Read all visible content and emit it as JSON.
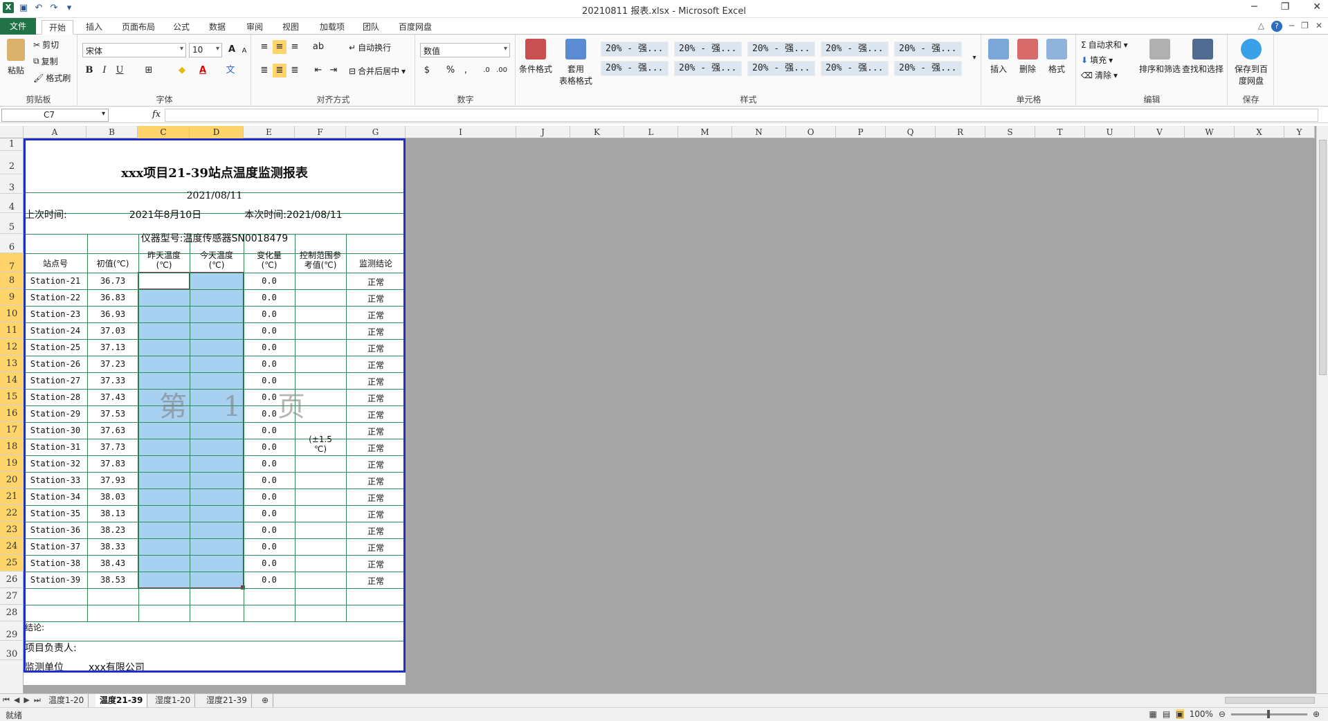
{
  "window": {
    "title": "20210811 报表.xlsx  -  Microsoft Excel",
    "app_icon": "X",
    "qat": [
      "save-icon",
      "undo-icon",
      "redo-icon",
      "customize-icon"
    ],
    "controls": [
      "─",
      "❐",
      "✕"
    ]
  },
  "tabs": [
    "文件",
    "开始",
    "插入",
    "页面布局",
    "公式",
    "数据",
    "审阅",
    "视图",
    "加载项",
    "团队",
    "百度网盘"
  ],
  "ribbon": {
    "clipboard": {
      "label": "剪贴板",
      "paste": "粘贴",
      "cut": "剪切",
      "copy": "复制",
      "format_painter": "格式刷"
    },
    "font": {
      "label": "字体",
      "name": "宋体",
      "size": "10",
      "bold": "B",
      "italic": "I",
      "underline": "U",
      "grow": "A",
      "shrink": "A"
    },
    "alignment": {
      "label": "对齐方式",
      "wrap": "自动换行",
      "merge": "合并后居中"
    },
    "number": {
      "label": "数字",
      "format": "数值",
      "percent": "%",
      "comma": ","
    },
    "styles": {
      "label": "样式",
      "cond": "条件格式",
      "table": "套用\n表格格式",
      "cells": [
        "20% - 强...",
        "20% - 强...",
        "20% - 强...",
        "20% - 强...",
        "20% - 强...",
        "20% - 强...",
        "20% - 强...",
        "20% - 强...",
        "20% - 强...",
        "20% - 强..."
      ]
    },
    "cells": {
      "label": "单元格",
      "insert": "插入",
      "delete": "删除",
      "format": "格式"
    },
    "editing": {
      "label": "编辑",
      "autosum": "自动求和",
      "fill": "填充",
      "clear": "清除",
      "sort": "排序和筛选",
      "find": "查找和选择"
    },
    "save": {
      "label": "保存",
      "baidu": "保存到百\n度网盘"
    }
  },
  "formula_bar": {
    "name_box": "C7",
    "fx": "fx",
    "value": ""
  },
  "columns": [
    "A",
    "B",
    "C",
    "D",
    "E",
    "F",
    "G",
    "I",
    "J",
    "K",
    "L",
    "M",
    "N",
    "O",
    "P",
    "Q",
    "R",
    "S",
    "T",
    "U",
    "V",
    "W",
    "X",
    "Y"
  ],
  "rows": [
    "1",
    "2",
    "3",
    "4",
    "5",
    "6",
    "7",
    "8",
    "9",
    "10",
    "11",
    "12",
    "13",
    "14",
    "15",
    "16",
    "17",
    "18",
    "19",
    "20",
    "21",
    "22",
    "23",
    "24",
    "25",
    "26",
    "27",
    "28",
    "29",
    "30"
  ],
  "report": {
    "title": "xxx项目21-39站点温度监测报表",
    "date": "2021/08/11",
    "last_time_label": "上次时间:",
    "last_time": "2021年8月10日",
    "this_time": "本次时间:2021/08/11",
    "instrument": "仪器型号:温度传感器SN0018479",
    "headers": [
      "站点号",
      "初值(℃)",
      "昨天温度\n(℃)",
      "今天温度\n(℃)",
      "变化量\n(℃)",
      "控制范围参\n考值(℃)",
      "监测结论"
    ],
    "range_value": "(±1.5\n℃)",
    "rows": [
      {
        "station": "Station-21",
        "init": "36.73",
        "change": "0.0",
        "result": "正常"
      },
      {
        "station": "Station-22",
        "init": "36.83",
        "change": "0.0",
        "result": "正常"
      },
      {
        "station": "Station-23",
        "init": "36.93",
        "change": "0.0",
        "result": "正常"
      },
      {
        "station": "Station-24",
        "init": "37.03",
        "change": "0.0",
        "result": "正常"
      },
      {
        "station": "Station-25",
        "init": "37.13",
        "change": "0.0",
        "result": "正常"
      },
      {
        "station": "Station-26",
        "init": "37.23",
        "change": "0.0",
        "result": "正常"
      },
      {
        "station": "Station-27",
        "init": "37.33",
        "change": "0.0",
        "result": "正常"
      },
      {
        "station": "Station-28",
        "init": "37.43",
        "change": "0.0",
        "result": "正常"
      },
      {
        "station": "Station-29",
        "init": "37.53",
        "change": "0.0",
        "result": "正常"
      },
      {
        "station": "Station-30",
        "init": "37.63",
        "change": "0.0",
        "result": "正常"
      },
      {
        "station": "Station-31",
        "init": "37.73",
        "change": "0.0",
        "result": "正常"
      },
      {
        "station": "Station-32",
        "init": "37.83",
        "change": "0.0",
        "result": "正常"
      },
      {
        "station": "Station-33",
        "init": "37.93",
        "change": "0.0",
        "result": "正常"
      },
      {
        "station": "Station-34",
        "init": "38.03",
        "change": "0.0",
        "result": "正常"
      },
      {
        "station": "Station-35",
        "init": "38.13",
        "change": "0.0",
        "result": "正常"
      },
      {
        "station": "Station-36",
        "init": "38.23",
        "change": "0.0",
        "result": "正常"
      },
      {
        "station": "Station-37",
        "init": "38.33",
        "change": "0.0",
        "result": "正常"
      },
      {
        "station": "Station-38",
        "init": "38.43",
        "change": "0.0",
        "result": "正常"
      },
      {
        "station": "Station-39",
        "init": "38.53",
        "change": "0.0",
        "result": "正常"
      }
    ],
    "conclusion": "结论:",
    "manager": "项目负责人:",
    "unit_label": "监测单位",
    "unit": "xxx有限公司",
    "watermark": "第 1 页"
  },
  "sheet_tabs": [
    "温度1-20",
    "温度21-39",
    "湿度1-20",
    "湿度21-39"
  ],
  "status": {
    "ready": "就绪",
    "zoom": "100%"
  }
}
